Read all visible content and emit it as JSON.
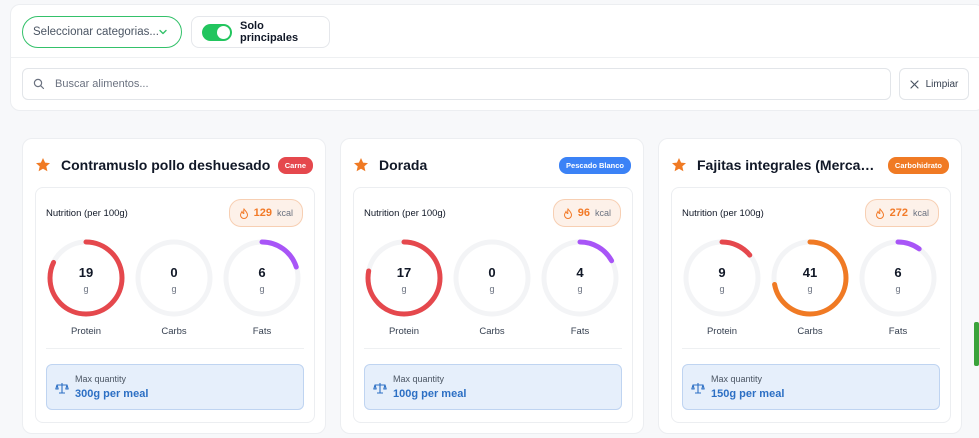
{
  "filters": {
    "category_placeholder": "Seleccionar categorias...",
    "toggle_label": "Solo principales",
    "toggle_on": true,
    "search_placeholder": "Buscar alimentos...",
    "clear_label": "Limpiar"
  },
  "labels": {
    "nutrition": "Nutrition (per 100g)",
    "kcal_unit": "kcal",
    "gram_unit": "g",
    "protein": "Protein",
    "carbs": "Carbs",
    "fats": "Fats",
    "max_quantity": "Max quantity"
  },
  "colors": {
    "protein": "#e5484d",
    "carbs": "#f07a24",
    "fats": "#a855f7",
    "star": "#f07a24",
    "toggle": "#22c55e"
  },
  "cards": [
    {
      "name": "Contramuslo pollo deshuesado",
      "badge": "Carne",
      "badge_color": "#e5484d",
      "kcal": "129",
      "protein": "19",
      "carbs": "0",
      "fats": "6",
      "protein_fraction": 0.82,
      "carbs_fraction": 0,
      "fats_fraction": 0.2,
      "max_quantity": "300g per meal"
    },
    {
      "name": "Dorada",
      "badge": "Pescado Blanco",
      "badge_color": "#3b82f6",
      "kcal": "96",
      "protein": "17",
      "carbs": "0",
      "fats": "4",
      "protein_fraction": 0.78,
      "carbs_fraction": 0,
      "fats_fraction": 0.17,
      "max_quantity": "100g per meal"
    },
    {
      "name": "Fajitas integrales (Mercadona)",
      "badge": "Carbohidrato",
      "badge_color": "#f07a24",
      "kcal": "272",
      "protein": "9",
      "carbs": "41",
      "fats": "6",
      "protein_fraction": 0.14,
      "carbs_fraction": 0.72,
      "fats_fraction": 0.1,
      "max_quantity": "150g per meal"
    }
  ]
}
